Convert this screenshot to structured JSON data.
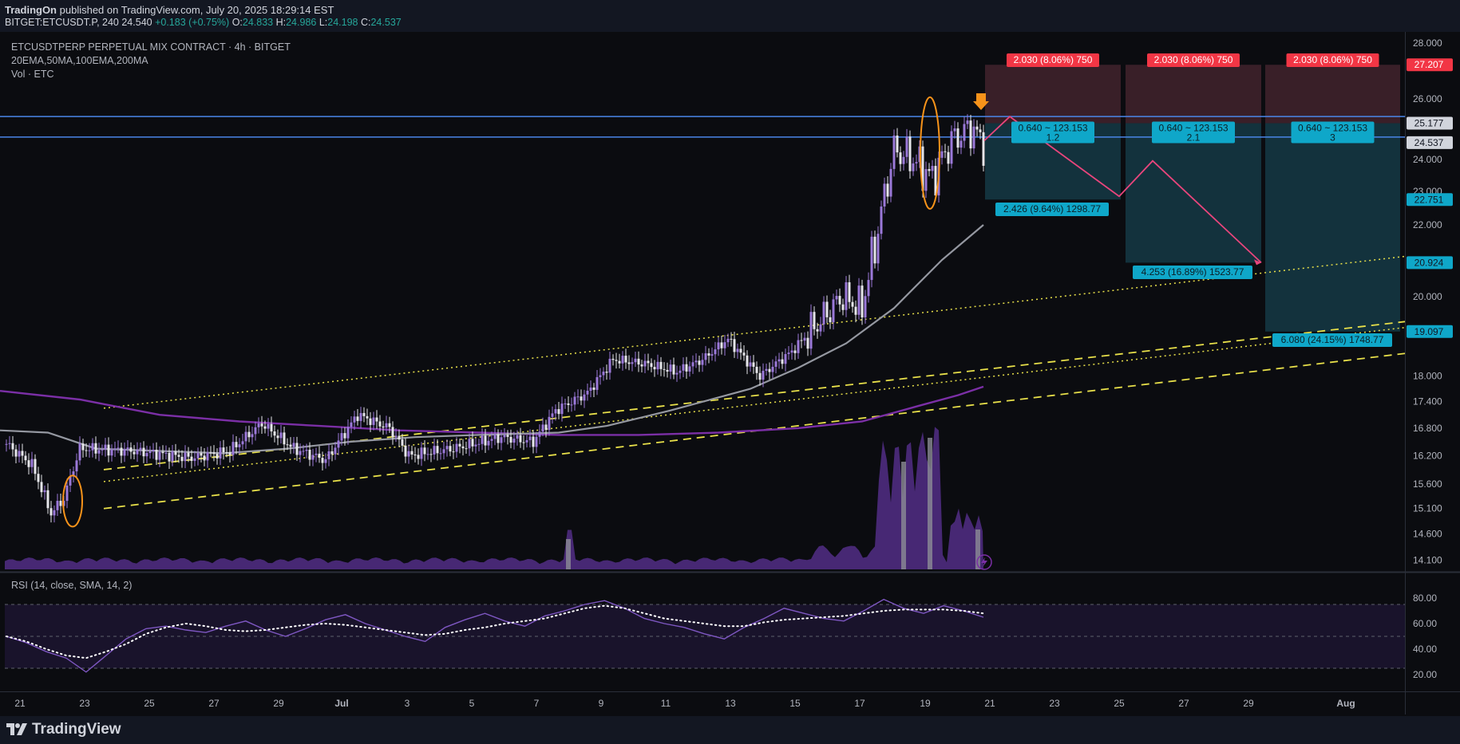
{
  "header": {
    "publisher": "TradingOn",
    "published_text": "published on TradingView.com, July 20, 2025 18:29:14 EST",
    "symbol": "BITGET:ETCUSDT.P, 240",
    "last": "24.540",
    "change": "+0.183 (+0.75%)",
    "open": "24.833",
    "high": "24.986",
    "low": "24.198",
    "close": "24.537"
  },
  "legend": {
    "title": "ETCUSDTPERP PERPETUAL MIX CONTRACT · 4h · BITGET",
    "indicators": "20EMA,50MA,100EMA,200MA",
    "volume": "Vol · ETC"
  },
  "rsi_legend": "RSI (14, close, SMA, 14, 2)",
  "footer": {
    "logo_text": "TradingView"
  },
  "colors": {
    "background": "#0b0c10",
    "candle_up": "#9b79d9",
    "candle_down": "#e6e6ea",
    "ma50": "#9598a1",
    "ma200": "#7b2fa6",
    "horizontal_line": "#4a86e8",
    "channel": "#e8e04a",
    "stop_zone": "#4a2530",
    "target_zone": "#153c48",
    "stop_label": "#f23645",
    "target_label": "#0fa7c9",
    "projection": "#e9457c",
    "highlight": "#f7931a"
  },
  "chart_data": {
    "type": "candlestick",
    "price_axis": {
      "ticks": [
        "28.000",
        "27.207",
        "26.000",
        "25.177",
        "24.537",
        "24.000",
        "23.000",
        "22.751",
        "22.000",
        "20.924",
        "20.000",
        "19.097",
        "18.000",
        "17.400",
        "16.800",
        "16.200",
        "15.600",
        "15.100",
        "14.600",
        "14.100"
      ],
      "markers": [
        {
          "value": "27.207",
          "kind": "stop"
        },
        {
          "value": "25.177",
          "kind": "entry"
        },
        {
          "value": "24.537",
          "kind": "last"
        },
        {
          "value": "22.751",
          "kind": "target"
        },
        {
          "value": "20.924",
          "kind": "target"
        },
        {
          "value": "19.097",
          "kind": "target"
        }
      ],
      "scale": "log"
    },
    "time_axis": [
      "21",
      "23",
      "25",
      "27",
      "29",
      "Jul",
      "3",
      "5",
      "7",
      "9",
      "11",
      "13",
      "15",
      "17",
      "19",
      "21",
      "23",
      "25",
      "27",
      "29",
      "Aug"
    ],
    "price_range": [
      13.9,
      28.3
    ],
    "horizontal_levels": [
      25.4,
      24.72
    ],
    "ohlc_sampled": [
      {
        "t": 0,
        "c": 16.45
      },
      {
        "t": 8,
        "c": 16.0
      },
      {
        "t": 14,
        "c": 15.0
      },
      {
        "t": 18,
        "c": 15.3
      },
      {
        "t": 23,
        "c": 16.35
      },
      {
        "t": 40,
        "c": 16.3
      },
      {
        "t": 58,
        "c": 16.15
      },
      {
        "t": 70,
        "c": 16.3
      },
      {
        "t": 80,
        "c": 16.9
      },
      {
        "t": 90,
        "c": 16.35
      },
      {
        "t": 100,
        "c": 16.1
      },
      {
        "t": 110,
        "c": 17.1
      },
      {
        "t": 120,
        "c": 16.8
      },
      {
        "t": 126,
        "c": 16.2
      },
      {
        "t": 140,
        "c": 16.35
      },
      {
        "t": 155,
        "c": 16.6
      },
      {
        "t": 165,
        "c": 16.5
      },
      {
        "t": 172,
        "c": 17.2
      },
      {
        "t": 182,
        "c": 17.6
      },
      {
        "t": 190,
        "c": 18.4
      },
      {
        "t": 200,
        "c": 18.3
      },
      {
        "t": 210,
        "c": 18.1
      },
      {
        "t": 218,
        "c": 18.4
      },
      {
        "t": 226,
        "c": 18.9
      },
      {
        "t": 236,
        "c": 18.0
      },
      {
        "t": 246,
        "c": 18.6
      },
      {
        "t": 254,
        "c": 19.3
      },
      {
        "t": 262,
        "c": 20.0
      },
      {
        "t": 268,
        "c": 19.7
      },
      {
        "t": 272,
        "c": 21.4
      },
      {
        "t": 278,
        "c": 24.3
      },
      {
        "t": 284,
        "c": 24.0
      },
      {
        "t": 290,
        "c": 23.4
      },
      {
        "t": 296,
        "c": 24.6
      },
      {
        "t": 302,
        "c": 25.0
      },
      {
        "t": 306,
        "c": 24.54
      }
    ],
    "positions": [
      {
        "stop_label": "2.030 (8.06%) 750",
        "entry_label": "0.640 ~ 123.153",
        "ratio": "1.2",
        "target_label": "2.426 (9.64%) 1298.77",
        "entry": 25.177,
        "stop": 27.207,
        "target": 22.751
      },
      {
        "stop_label": "2.030 (8.06%) 750",
        "entry_label": "0.640 ~ 123.153",
        "ratio": "2.1",
        "target_label": "4.253 (16.89%) 1523.77",
        "entry": 25.177,
        "stop": 27.207,
        "target": 20.924
      },
      {
        "stop_label": "2.030 (8.06%) 750",
        "entry_label": "0.640 ~ 123.153",
        "ratio": "3",
        "target_label": "6.080 (24.15%) 1748.77",
        "entry": 25.177,
        "stop": 27.207,
        "target": 19.097
      }
    ],
    "projection_path": [
      {
        "date": "Jul 20",
        "y": 24.6
      },
      {
        "date": "Jul 21",
        "y": 25.4
      },
      {
        "date": "Jul 25",
        "y": 22.85
      },
      {
        "date": "Jul 26",
        "y": 23.95
      },
      {
        "date": "Jul 29",
        "y": 20.924
      }
    ],
    "volume": {
      "peaks_at": [
        "Jul 8",
        "Jul 18",
        "Jul 19",
        "Jul 20"
      ]
    },
    "rsi": {
      "ticks": [
        "80.00",
        "60.00",
        "40.00",
        "20.00"
      ],
      "upper": 75,
      "lower": 25,
      "mid": 50,
      "values": [
        50,
        45,
        38,
        33,
        22,
        35,
        48,
        56,
        58,
        55,
        53,
        58,
        62,
        55,
        50,
        56,
        63,
        67,
        60,
        55,
        50,
        46,
        57,
        63,
        68,
        62,
        58,
        66,
        70,
        75,
        78,
        72,
        64,
        60,
        57,
        52,
        48,
        57,
        64,
        72,
        68,
        64,
        62,
        70,
        79,
        72,
        68,
        74,
        70,
        65
      ],
      "sma": [
        50,
        46,
        40,
        35,
        33,
        38,
        44,
        52,
        57,
        60,
        58,
        55,
        54,
        55,
        57,
        59,
        60,
        59,
        57,
        55,
        53,
        51,
        52,
        55,
        57,
        60,
        62,
        64,
        68,
        72,
        74,
        72,
        68,
        64,
        62,
        60,
        58,
        58,
        61,
        63,
        64,
        65,
        66,
        68,
        70,
        71,
        71,
        71,
        70,
        68
      ]
    }
  }
}
